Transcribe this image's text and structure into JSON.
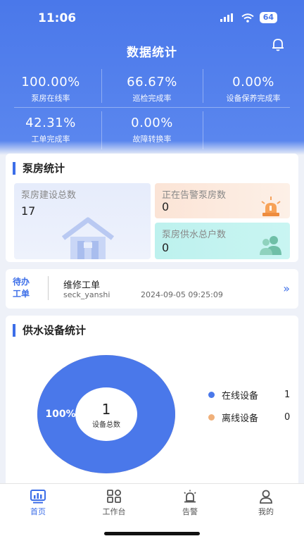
{
  "status_bar": {
    "time": "11:06",
    "battery": "64"
  },
  "header": {
    "title": "数据统计"
  },
  "stats": [
    {
      "value": "100.00%",
      "label": "泵房在线率"
    },
    {
      "value": "66.67%",
      "label": "巡检完成率"
    },
    {
      "value": "0.00%",
      "label": "设备保养完成率"
    },
    {
      "value": "42.31%",
      "label": "工单完成率"
    },
    {
      "value": "0.00%",
      "label": "故障转换率"
    }
  ],
  "pump_stats": {
    "title": "泵房统计",
    "total_label": "泵房建设总数",
    "total_value": "17",
    "alarm_label": "正在告警泵房数",
    "alarm_value": "0",
    "users_label": "泵房供水总户数",
    "users_value": "0"
  },
  "todo": {
    "badge": "待办工单",
    "title": "维修工单",
    "user": "seck_yanshi",
    "time": "2024-09-05 09:25:09",
    "arrow": "»"
  },
  "device_stats": {
    "title": "供水设备统计",
    "center_value": "1",
    "center_label": "设备总数",
    "percent_label": "100%",
    "legend": [
      {
        "label": "在线设备",
        "count": "1",
        "color": "#4a78ea"
      },
      {
        "label": "离线设备",
        "count": "0",
        "color": "#f0b07a"
      }
    ]
  },
  "chart_data": {
    "type": "pie",
    "categories": [
      "在线设备",
      "离线设备"
    ],
    "values": [
      1,
      0
    ],
    "title": "供水设备统计"
  },
  "tabbar": [
    {
      "label": "首页",
      "icon": "dashboard-icon",
      "active": true
    },
    {
      "label": "工作台",
      "icon": "grid-icon",
      "active": false
    },
    {
      "label": "告警",
      "icon": "alarm-icon",
      "active": false
    },
    {
      "label": "我的",
      "icon": "person-icon",
      "active": false
    }
  ]
}
